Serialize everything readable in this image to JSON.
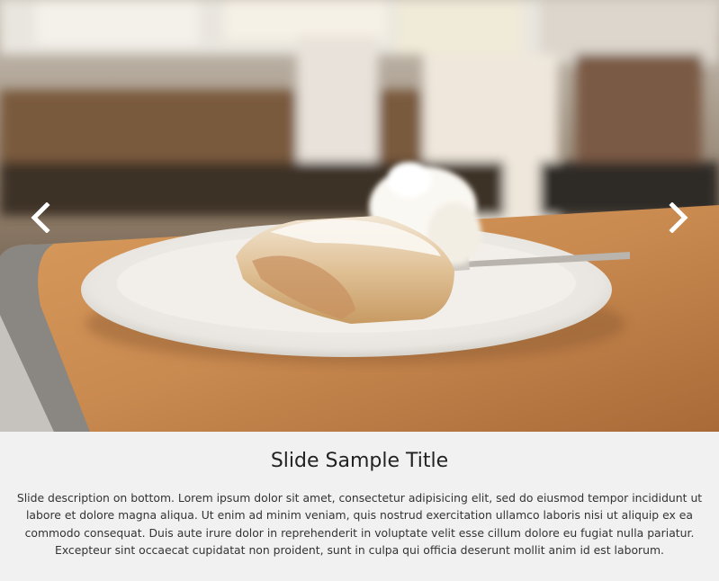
{
  "slide": {
    "image_alt": "Apple strudel with whipped cream on a white plate in a cafe",
    "title": "Slide Sample Title",
    "description": "Slide description on bottom. Lorem ipsum dolor sit amet, consectetur adipisicing elit, sed do eiusmod tempor incididunt ut labore et dolore magna aliqua. Ut enim ad minim veniam, quis nostrud exercitation ullamco laboris nisi ut aliquip ex ea commodo consequat. Duis aute irure dolor in reprehenderit in voluptate velit esse cillum dolore eu fugiat nulla pariatur. Excepteur sint occaecat cupidatat non proident, sunt in culpa qui officia deserunt mollit anim id est laborum."
  },
  "navigation": {
    "prev_icon": "chevron-left-icon",
    "next_icon": "chevron-right-icon"
  },
  "colors": {
    "caption_background": "#f1f1f1",
    "title_text": "#222222",
    "description_text": "#333333",
    "arrow": "#ffffff"
  }
}
